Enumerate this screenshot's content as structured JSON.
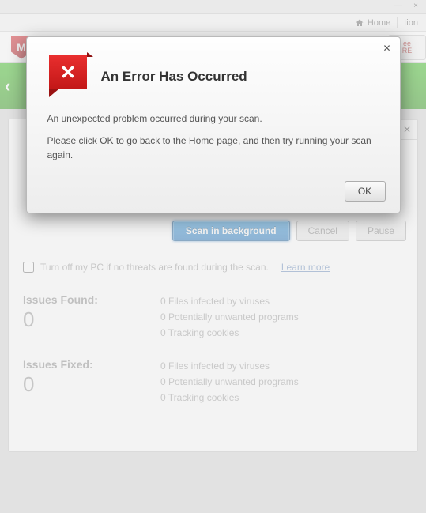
{
  "window": {
    "home_label": "Home",
    "right_tab_fragment": "tion",
    "brand_letter": "M",
    "side_chip_line1": "ee",
    "side_chip_line2": "RE"
  },
  "scan": {
    "scan_bg_label": "Scan in background",
    "cancel_label": "Cancel",
    "pause_label": "Pause",
    "checkbox_label": "Turn off my PC if no threats are found during the scan.",
    "learn_more_label": "Learn more",
    "found": {
      "label": "Issues Found:",
      "count": "0",
      "lines": [
        "0 Files infected by viruses",
        "0 Potentially unwanted programs",
        "0 Tracking cookies"
      ]
    },
    "fixed": {
      "label": "Issues Fixed:",
      "count": "0",
      "lines": [
        "0 Files infected by viruses",
        "0 Potentially unwanted programs",
        "0 Tracking cookies"
      ]
    }
  },
  "modal": {
    "title": "An Error Has Occurred",
    "line1": "An unexpected problem occurred during your scan.",
    "line2": "Please click OK to go back to the Home page, and then try running your scan again.",
    "ok_label": "OK"
  }
}
